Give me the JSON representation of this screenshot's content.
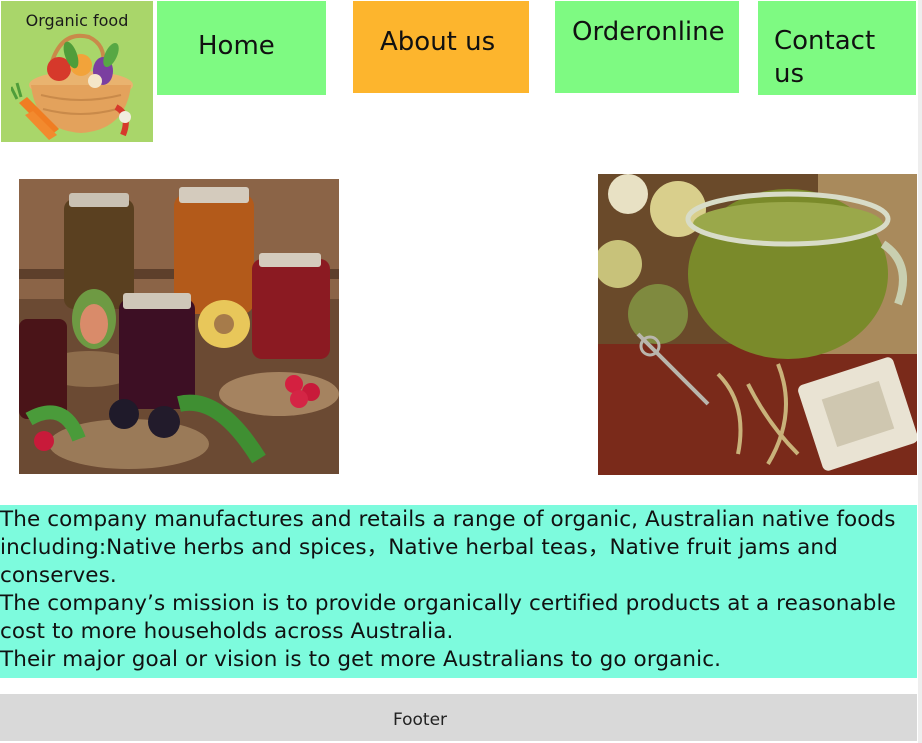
{
  "logo": {
    "text": "Organic food",
    "icon": "vegetable-basket-icon"
  },
  "nav": {
    "home": "Home",
    "about": "About us",
    "order": "Orderonline",
    "contact": "Contact us"
  },
  "colors": {
    "nav_default": "#7efa82",
    "nav_active": "#fdb52d",
    "logo_bg": "#a9d66a",
    "text_panel": "#7dfbdd",
    "footer": "#d9d9d9"
  },
  "images": {
    "left": "jam-jars-photo",
    "right": "herbal-tea-photo"
  },
  "about": {
    "p1": "The company manufactures and retails a range of organic, Australian native foods including:Native herbs and spices，Native herbal teas，Native fruit jams and conserves.",
    "p2": "The company’s mission is to provide organically certified products at a reasonable cost to more households across Australia.",
    "p3": "Their major goal or vision is to get more Australians to go organic."
  },
  "footer": {
    "label": "Footer"
  }
}
